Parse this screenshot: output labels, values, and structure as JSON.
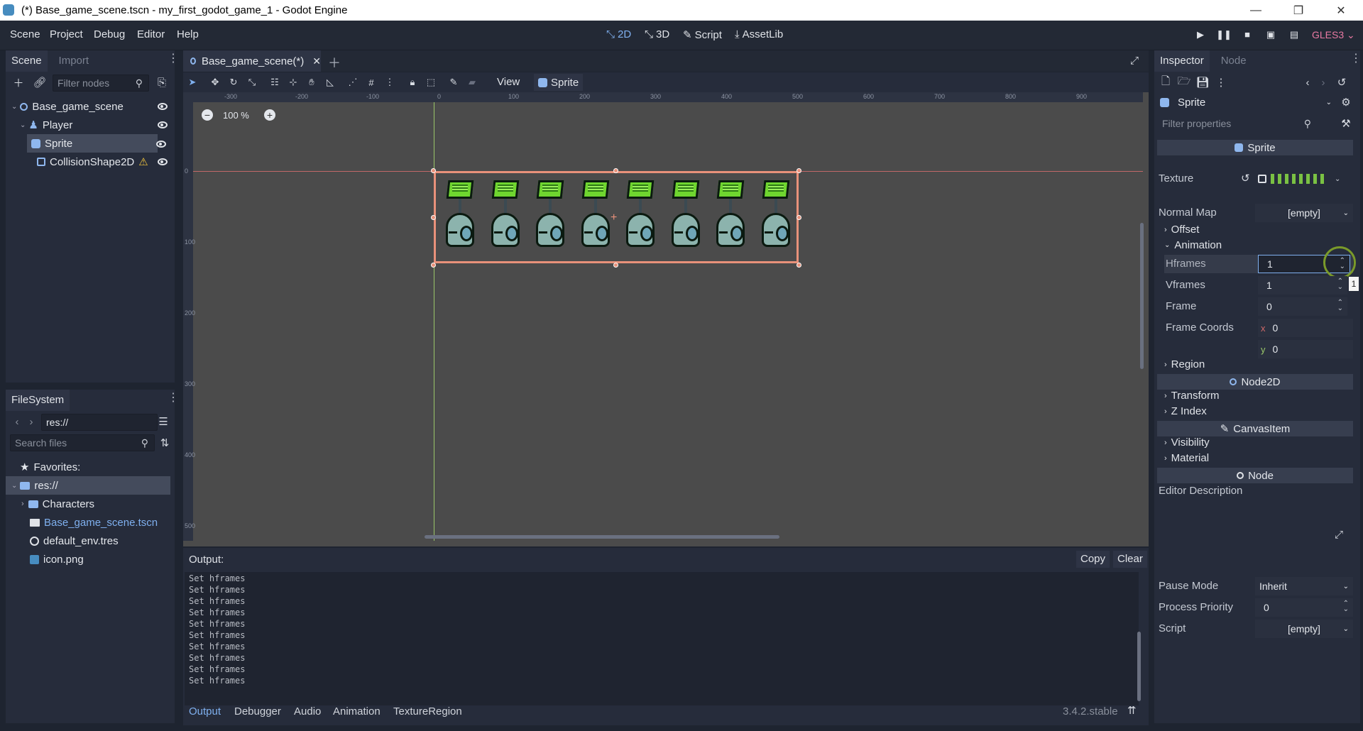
{
  "window": {
    "title": "(*) Base_game_scene.tscn - my_first_godot_game_1 - Godot Engine",
    "minimize": "—",
    "maximize": "❐",
    "close": "✕"
  },
  "menu": [
    "Scene",
    "Project",
    "Debug",
    "Editor",
    "Help"
  ],
  "workspaces": {
    "d2": "2D",
    "d3": "3D",
    "script": "Script",
    "assetlib": "AssetLib"
  },
  "renderer": "GLES3",
  "scene_dock": {
    "tab_scene": "Scene",
    "tab_import": "Import",
    "filter_placeholder": "Filter nodes",
    "tree": [
      {
        "label": "Base_game_scene"
      },
      {
        "label": "Player"
      },
      {
        "label": "Sprite"
      },
      {
        "label": "CollisionShape2D"
      }
    ]
  },
  "filesystem_dock": {
    "tab": "FileSystem",
    "path": "res://",
    "search_placeholder": "Search files",
    "favorites": "Favorites:",
    "items": [
      {
        "label": "res://"
      },
      {
        "label": "Characters"
      },
      {
        "label": "Base_game_scene.tscn"
      },
      {
        "label": "default_env.tres"
      },
      {
        "label": "icon.png"
      }
    ]
  },
  "editor": {
    "scene_tab": "Base_game_scene(*)",
    "view_menu": "View",
    "sprite_menu": "Sprite",
    "zoom": "100 %",
    "ruler_h": [
      "-300",
      "-200",
      "-100",
      "0",
      "100",
      "200",
      "300",
      "400",
      "500",
      "600",
      "700",
      "800",
      "900"
    ],
    "ruler_v": [
      "0",
      "100",
      "200",
      "300",
      "400",
      "500"
    ]
  },
  "output": {
    "label": "Output:",
    "copy": "Copy",
    "clear": "Clear",
    "lines": [
      "Set hframes",
      "Set hframes",
      "Set hframes",
      "Set hframes",
      "Set hframes",
      "Set hframes",
      "Set hframes",
      "Set hframes",
      "Set hframes",
      "Set hframes"
    ]
  },
  "bottom_tabs": [
    "Output",
    "Debugger",
    "Audio",
    "Animation",
    "TextureRegion"
  ],
  "version": "3.4.2.stable",
  "inspector": {
    "tab_inspector": "Inspector",
    "tab_node": "Node",
    "object": "Sprite",
    "filter_placeholder": "Filter properties",
    "sec_sprite": "Sprite",
    "texture": "Texture",
    "normal_map": "Normal Map",
    "normal_map_value": "[empty]",
    "offset": "Offset",
    "animation": "Animation",
    "hframes": "Hframes",
    "hframes_value": "1",
    "tooltip_value": "1",
    "vframes": "Vframes",
    "vframes_value": "1",
    "frame": "Frame",
    "frame_value": "0",
    "frame_coords": "Frame Coords",
    "fc_x_label": "x",
    "fc_x": "0",
    "fc_y_label": "y",
    "fc_y": "0",
    "region": "Region",
    "sec_node2d": "Node2D",
    "transform": "Transform",
    "z_index": "Z Index",
    "sec_canvasitem": "CanvasItem",
    "visibility": "Visibility",
    "material": "Material",
    "sec_node": "Node",
    "editor_description": "Editor Description",
    "pause_mode": "Pause Mode",
    "pause_mode_value": "Inherit",
    "process_priority": "Process Priority",
    "process_priority_value": "0",
    "script": "Script",
    "script_value": "[empty]"
  }
}
